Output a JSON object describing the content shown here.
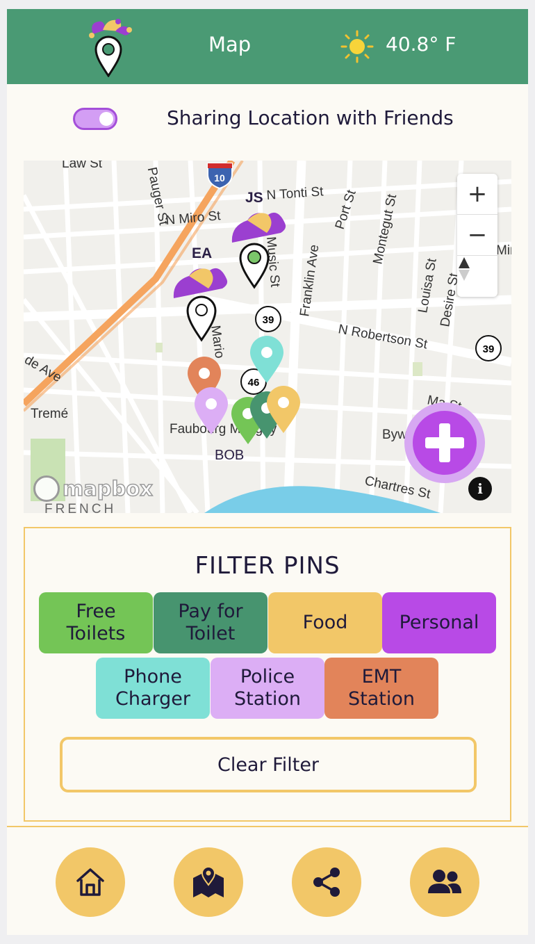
{
  "header": {
    "title": "Map",
    "temperature": "40.8° F",
    "logo_icon": "jester-pin-logo-icon",
    "weather_icon": "sun-icon",
    "bg_color": "#4a9a74"
  },
  "sharing": {
    "toggle_on": true,
    "label": "Sharing Location with Friends",
    "toggle_color": "#a44fd9"
  },
  "map": {
    "streets": [
      "Law St",
      "Pauger St",
      "N Miro St",
      "N Tonti St",
      "Port St",
      "Montegut St",
      "Franklin Ave",
      "Music St",
      "Louisa St",
      "Desire St",
      "N Robertson St",
      "Marigny",
      "Tremé",
      "Faubourg Marigny",
      "Bywater",
      "Chartres St",
      "Mazant St",
      "ade Ave",
      "FRENCH",
      "Mir"
    ],
    "street_labels": {
      "law": "Law St",
      "pauger": "Pauger St",
      "miro": "N Miro St",
      "tonti": "N Tonti St",
      "port": "Port St",
      "montegut": "Montegut St",
      "franklin": "Franklin Ave",
      "music": "Music St",
      "louisa": "Louisa St",
      "desire": "Desire St",
      "robertson": "N Robertson St",
      "marigny": "Mario",
      "treme": "Tremé",
      "faubourg": "Faubourg Marigny",
      "bywater": "Byw",
      "chartres": "Chartres St",
      "mazant": "Ma     St",
      "ade": "de Ave",
      "french": "FRENCH",
      "mir": "Mir"
    },
    "shields": {
      "interstate": "10",
      "route_a": "39",
      "route_b": "39",
      "route_c": "46"
    },
    "friends": [
      {
        "initials": "JS"
      },
      {
        "initials": "EA"
      },
      {
        "initials": "BOB"
      }
    ],
    "zoom_in": "+",
    "zoom_out": "−",
    "compass_icon": "compass-icon",
    "attribution": "mapbox",
    "info": "i",
    "add_icon": "plus-icon"
  },
  "filter": {
    "title": "FILTER PINS",
    "chips": [
      {
        "label_1": "Free",
        "label_2": "Toilets",
        "color": "#74c556"
      },
      {
        "label_1": "Pay for",
        "label_2": "Toilet",
        "color": "#47946f"
      },
      {
        "label_1": "Food",
        "label_2": "",
        "color": "#f2c768"
      },
      {
        "label_1": "Personal",
        "label_2": "",
        "color": "#b84ae6"
      },
      {
        "label_1": "Phone",
        "label_2": "Charger",
        "color": "#7fe0d6"
      },
      {
        "label_1": "Police",
        "label_2": "Station",
        "color": "#dcaef5"
      },
      {
        "label_1": "EMT",
        "label_2": "Station",
        "color": "#e2845a"
      }
    ],
    "clear_label": "Clear Filter"
  },
  "nav": {
    "items": [
      {
        "name": "home-icon"
      },
      {
        "name": "map-pin-icon"
      },
      {
        "name": "share-icon"
      },
      {
        "name": "friends-icon"
      }
    ],
    "color": "#f2c768"
  }
}
